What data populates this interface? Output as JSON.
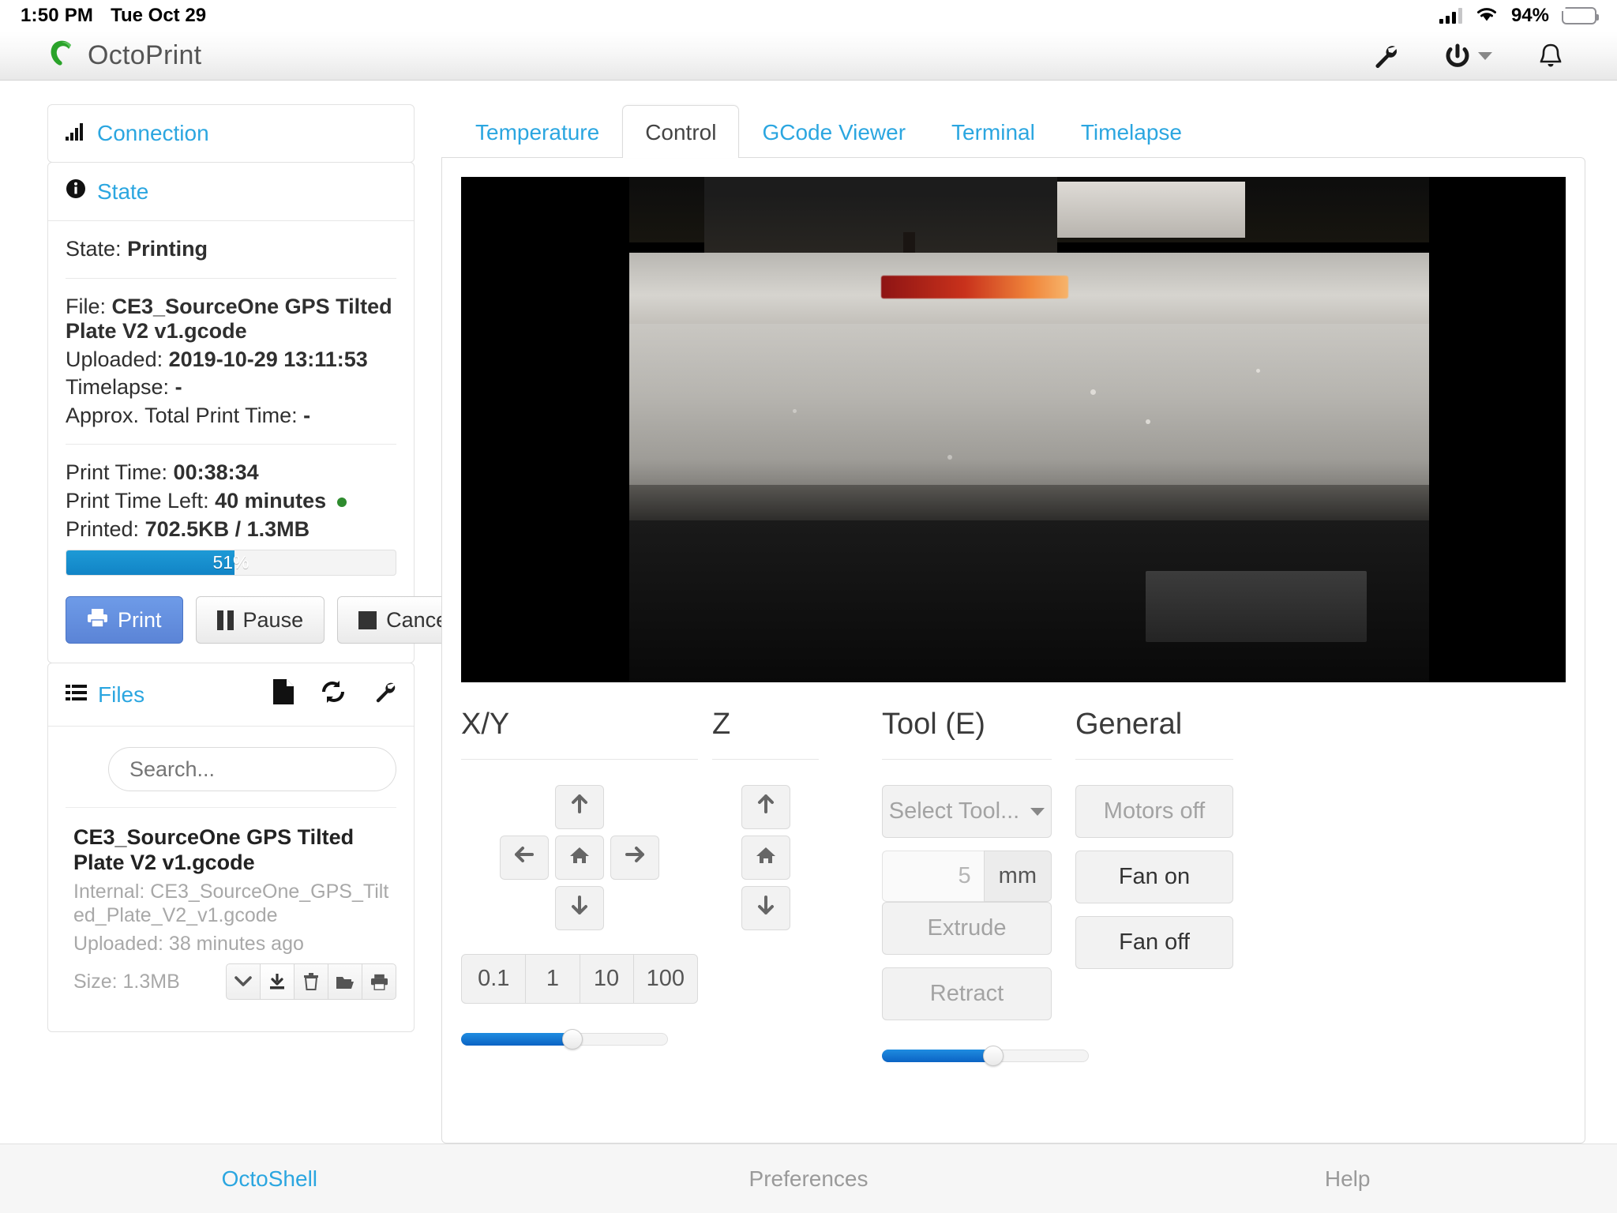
{
  "statusbar": {
    "time": "1:50 PM",
    "date": "Tue Oct 29",
    "battery_percent": "94%",
    "cell_icon": "cellular-bars-icon",
    "wifi_icon": "wifi-icon",
    "battery_icon": "battery-charging-icon"
  },
  "navbar": {
    "brand": "OctoPrint",
    "logo_icon": "octoprint-logo-icon",
    "settings_icon": "wrench-icon",
    "power_icon": "power-icon",
    "power_caret_icon": "caret-down-icon",
    "notifications_icon": "bell-icon"
  },
  "sidebar": {
    "connection": {
      "title": "Connection",
      "icon": "signal-bars-icon"
    },
    "state": {
      "title": "State",
      "icon": "info-circle-icon",
      "state_label": "State:",
      "state_value": "Printing",
      "file_label": "File:",
      "file_value": "CE3_SourceOne GPS Tilted Plate V2 v1.gcode",
      "uploaded_label": "Uploaded:",
      "uploaded_value": "2019-10-29 13:11:53",
      "timelapse_label": "Timelapse:",
      "timelapse_value": "-",
      "approx_label": "Approx. Total Print Time:",
      "approx_value": "-",
      "print_time_label": "Print Time:",
      "print_time_value": "00:38:34",
      "print_time_left_label": "Print Time Left:",
      "print_time_left_value": "40 minutes",
      "printed_label": "Printed:",
      "printed_value": "702.5KB / 1.3MB",
      "progress_percent": "51%",
      "progress_value": 51,
      "buttons": {
        "print": "Print",
        "pause": "Pause",
        "cancel": "Cancel",
        "print_icon": "printer-icon",
        "pause_icon": "pause-icon",
        "cancel_icon": "stop-icon"
      }
    },
    "files": {
      "title": "Files",
      "icon": "list-icon",
      "upload_icon": "file-icon",
      "refresh_icon": "refresh-icon",
      "settings_icon": "wrench-icon",
      "search_placeholder": "Search...",
      "item": {
        "name": "CE3_SourceOne GPS Tilted Plate V2 v1.gcode",
        "internal": "Internal: CE3_SourceOne_GPS_Tilted_Plate_V2_v1.gcode",
        "uploaded": "Uploaded: 38 minutes ago",
        "size": "Size: 1.3MB",
        "actions": {
          "more_icon": "chevron-down-icon",
          "download_icon": "download-icon",
          "delete_icon": "trash-icon",
          "load_icon": "folder-open-icon",
          "print_icon": "printer-icon"
        }
      }
    }
  },
  "main": {
    "tabs": [
      {
        "label": "Temperature",
        "active": false
      },
      {
        "label": "Control",
        "active": true
      },
      {
        "label": "GCode Viewer",
        "active": false
      },
      {
        "label": "Terminal",
        "active": false
      },
      {
        "label": "Timelapse",
        "active": false
      }
    ],
    "webcam": {
      "name": "webcam-stream"
    },
    "control": {
      "xy": {
        "title": "X/Y",
        "up_icon": "arrow-up-icon",
        "left_icon": "arrow-left-icon",
        "home_icon": "home-icon",
        "right_icon": "arrow-right-icon",
        "down_icon": "arrow-down-icon",
        "steps": [
          "0.1",
          "1",
          "10",
          "100"
        ]
      },
      "z": {
        "title": "Z",
        "up_icon": "arrow-up-icon",
        "home_icon": "home-icon",
        "down_icon": "arrow-down-icon"
      },
      "tool": {
        "title": "Tool (E)",
        "select_label": "Select Tool...",
        "select_caret_icon": "caret-down-icon",
        "amount_value": "5",
        "amount_unit": "mm",
        "extrude_label": "Extrude",
        "retract_label": "Retract"
      },
      "general": {
        "title": "General",
        "motors_off_label": "Motors off",
        "fan_on_label": "Fan on",
        "fan_off_label": "Fan off"
      },
      "sliders": [
        {
          "name": "feedrate-slider",
          "value": 50
        },
        {
          "name": "flowrate-slider",
          "value": 50
        }
      ]
    }
  },
  "footer": {
    "links": [
      {
        "label": "OctoShell",
        "accent": true
      },
      {
        "label": "Preferences",
        "accent": false
      },
      {
        "label": "Help",
        "accent": false
      }
    ]
  },
  "colors": {
    "accent_blue": "#2ba6e0",
    "progress_blue": "#1184c6",
    "primary_button": "#5b84d6",
    "battery_green": "#34c759",
    "status_dot_green": "#2e8b2e"
  }
}
